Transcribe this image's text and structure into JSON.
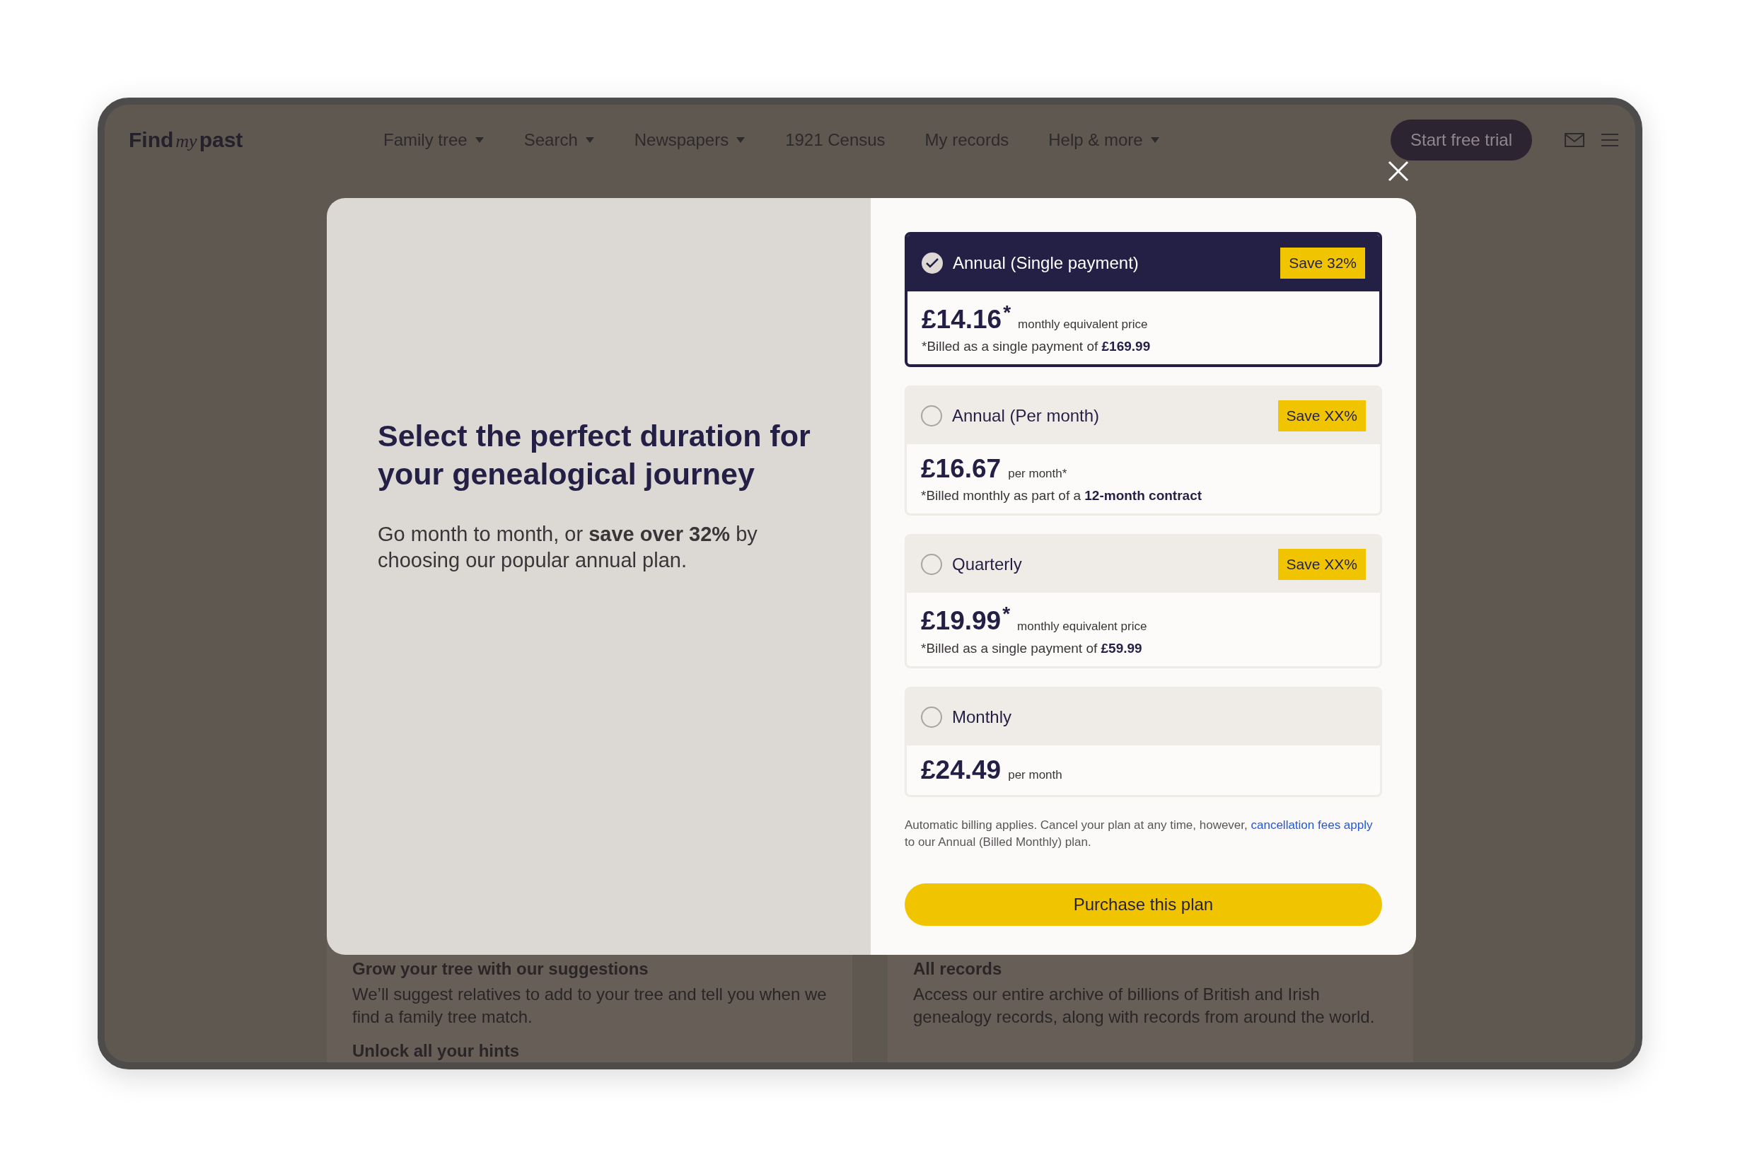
{
  "header": {
    "logo": {
      "first": "Find",
      "middle": "my",
      "last": "past"
    },
    "nav": [
      {
        "label": "Family tree",
        "dropdown": true
      },
      {
        "label": "Search",
        "dropdown": true
      },
      {
        "label": "Newspapers",
        "dropdown": true
      },
      {
        "label": "1921 Census",
        "dropdown": false
      },
      {
        "label": "My records",
        "dropdown": false
      },
      {
        "label": "Help & more",
        "dropdown": true
      }
    ],
    "cta": "Start free trial"
  },
  "background_cards": [
    {
      "title": "Grow your tree with our suggestions",
      "body": "We’ll suggest relatives to add to your tree and tell you when we find a family tree match.",
      "subtitle": "Unlock all your hints"
    },
    {
      "title": "All records",
      "body": "Access our entire archive of billions of British and Irish genealogy records, along with records from around the world."
    }
  ],
  "modal": {
    "heading": "Select the perfect duration for your genealogical journey",
    "intro": "Go month to month, or **save over 32%** by choosing our popular annual plan.",
    "plans": [
      {
        "name": "Annual (Single payment)",
        "selected": true,
        "badge": "Save 32%",
        "price": "£14.16",
        "price_mark": "*",
        "suffix": "monthly equivalent price",
        "note": "*Billed as a single payment of **£169.99**"
      },
      {
        "name": "Annual (Per month)",
        "selected": false,
        "badge": "Save XX%",
        "price": "£16.67",
        "suffix": "per month*",
        "note": "*Billed monthly as part of a **12-month contract**"
      },
      {
        "name": "Quarterly",
        "selected": false,
        "badge": "Save XX%",
        "price": "£19.99",
        "price_mark": "*",
        "suffix": "monthly equivalent price",
        "note": "*Billed as a single payment of **£59.99**"
      },
      {
        "name": "Monthly",
        "selected": false,
        "price": "£24.49",
        "suffix": "per month"
      }
    ],
    "disclaimer": {
      "before": "Automatic billing applies. Cancel your plan at any time, however,",
      "link": "cancellation fees apply",
      "after": "to our Annual (Billed Monthly) plan."
    },
    "button": "Purchase this plan"
  }
}
